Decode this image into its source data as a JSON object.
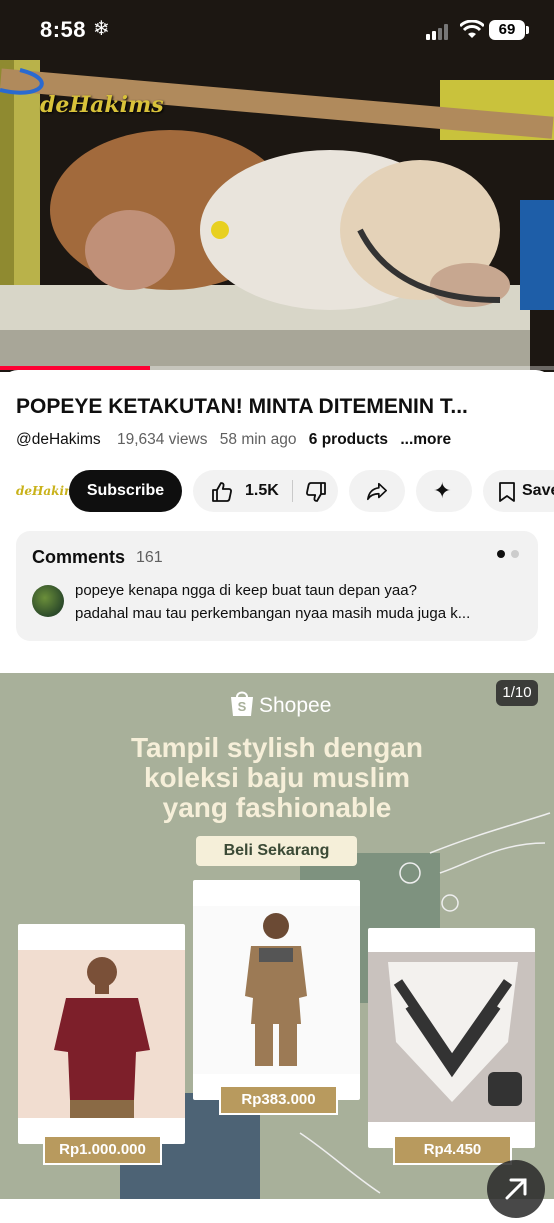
{
  "status_bar": {
    "time": "8:58",
    "focus_icon": "snowflake-icon",
    "battery": "69"
  },
  "video": {
    "watermark": "deHakims",
    "progress_fraction": 0.27
  },
  "video_info": {
    "title": "POPEYE KETAKUTAN! MINTA DITEMENIN T...",
    "channel": "@deHakims",
    "views": "19,634 views",
    "age": "58 min ago",
    "products": "6 products",
    "more": "...more"
  },
  "actions": {
    "channel_logo": "deHakims",
    "subscribe": "Subscribe",
    "likes": "1.5K",
    "save": "Save"
  },
  "comments": {
    "title": "Comments",
    "count": "161",
    "top_comment_line1": "popeye kenapa ngga di keep buat taun depan yaa?",
    "top_comment_line2": "padahal mau tau perkembangan nyaa masih muda juga k..."
  },
  "ad": {
    "counter": "1/10",
    "brand": "Shopee",
    "headline_line1": "Tampil stylish dengan",
    "headline_line2": "koleksi baju muslim",
    "headline_line3": "yang fashionable",
    "cta": "Beli Sekarang",
    "products": [
      {
        "price": "Rp1.000.000"
      },
      {
        "price": "Rp383.000"
      },
      {
        "price": "Rp4.450"
      }
    ]
  },
  "colors": {
    "accent_red": "#ff0033",
    "ad_background": "#a8b09a",
    "price_tag": "#b89a5e"
  }
}
